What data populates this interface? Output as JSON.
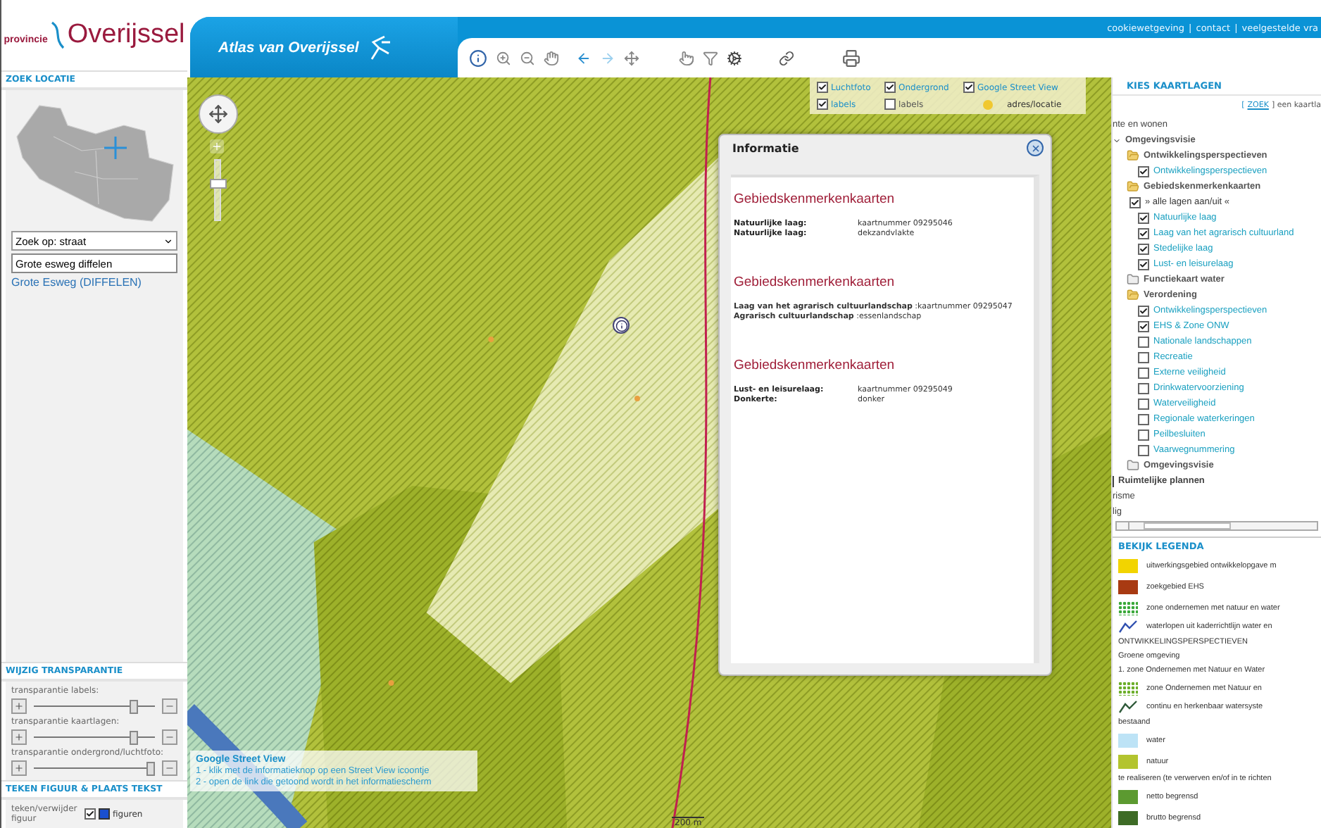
{
  "logo": {
    "prefix": "provincie",
    "name": "Overijssel"
  },
  "header": {
    "title": "Atlas van Overijssel",
    "separator": "|",
    "links": [
      {
        "label": "cookiewetgeving"
      },
      {
        "label": "contact"
      },
      {
        "label": "veelgestelde vra"
      }
    ]
  },
  "search_panel": {
    "title": "ZOEK LOCATIE",
    "select": {
      "value": "Zoek op: straat"
    },
    "input": {
      "value": "Grote esweg diffelen"
    },
    "results": [
      {
        "label": "Grote Esweg (DIFFELEN)"
      }
    ]
  },
  "transparency": {
    "title": "WIJZIG TRANSPARANTIE",
    "sliders": [
      {
        "label": "transparantie labels:",
        "level": 0.83
      },
      {
        "label": "transparantie kaartlagen:",
        "level": 0.83
      },
      {
        "label": "transparantie ondergrond/luchtfoto:",
        "level": 0.97
      }
    ]
  },
  "draw_panel": {
    "title": "TEKEN FIGUUR & PLAATS TEKST",
    "label": "teken/verwijder figuur",
    "checked": true,
    "option": "figuren"
  },
  "map": {
    "zoom": {
      "level": 0.62
    },
    "layers": [
      {
        "kind": "checkbox",
        "label": "Luchtfoto",
        "checked": true
      },
      {
        "kind": "checkbox",
        "label": "Ondergrond",
        "checked": true
      },
      {
        "kind": "checkbox",
        "label": "Google Street View",
        "checked": true
      },
      {
        "kind": "checkbox",
        "label": "labels",
        "checked": true
      },
      {
        "kind": "checkbox",
        "label": "labels",
        "checked": false
      },
      {
        "kind": "marker",
        "label": "adres/locatie"
      }
    ],
    "street_view": {
      "title": "Google Street View",
      "lines": [
        "1 - klik met de informatieknop op een Street View icoontje",
        "2 - open de link die getoond wordt in het informatiescherm"
      ]
    },
    "scale": "200 m"
  },
  "popup": {
    "title": "Informatie",
    "sections": [
      {
        "title": "Gebiedskenmerkenkaarten",
        "kind": "columns",
        "rows": [
          {
            "label": "Natuurlijke laag:",
            "value": "kaartnummer 09295046"
          },
          {
            "label": "Natuurlijke laag:",
            "value": "dekzandvlakte"
          }
        ]
      },
      {
        "title": "Gebiedskenmerkenkaarten",
        "kind": "inline",
        "rows": [
          {
            "text": "**Laag van het agrarisch cultuurlandschap** :kaartnummer 09295047"
          },
          {
            "text": "**Agrarisch cultuurlandschap** :essenlandschap"
          }
        ]
      },
      {
        "title": "Gebiedskenmerkenkaarten",
        "kind": "columns",
        "rows": [
          {
            "label": "Lust- en leisurelaag:",
            "value": "kaartnummer 09295049"
          },
          {
            "label": "Donkerte:",
            "value": "donker"
          }
        ]
      }
    ]
  },
  "layers_panel": {
    "title": "KIES KAARTLAGEN",
    "search_prefix": "[",
    "search_link": "ZOEK",
    "search_suffix": "] een kaartla",
    "tree": [
      {
        "kind": "text",
        "label": "nte en wonen"
      },
      {
        "kind": "group",
        "label": "Omgevingsvisie",
        "expanded": true,
        "children": [
          {
            "kind": "folder",
            "label": "Ontwikkelingsperspectieven",
            "expanded": true,
            "children": [
              {
                "kind": "layer",
                "label": "Ontwikkelingsperspectieven",
                "checked": true
              }
            ]
          },
          {
            "kind": "folder",
            "label": "Gebiedskenmerkenkaarten",
            "expanded": true,
            "children": [
              {
                "kind": "toggle",
                "label": "» alle lagen aan/uit «",
                "checked": true
              },
              {
                "kind": "layer",
                "label": "Natuurlijke laag",
                "checked": true
              },
              {
                "kind": "layer",
                "label": "Laag van het agrarisch cultuurland",
                "checked": true
              },
              {
                "kind": "layer",
                "label": "Stedelijke laag",
                "checked": true
              },
              {
                "kind": "layer",
                "label": "Lust- en leisurelaag",
                "checked": true
              }
            ]
          },
          {
            "kind": "folder",
            "label": "Functiekaart water",
            "expanded": false
          },
          {
            "kind": "folder",
            "label": "Verordening",
            "expanded": true,
            "children": [
              {
                "kind": "layer",
                "label": "Ontwikkelingsperspectieven",
                "checked": true
              },
              {
                "kind": "layer",
                "label": "EHS & Zone ONW",
                "checked": true
              },
              {
                "kind": "layer",
                "label": "Nationale landschappen",
                "checked": false
              },
              {
                "kind": "layer",
                "label": "Recreatie",
                "checked": false
              },
              {
                "kind": "layer",
                "label": "Externe veiligheid",
                "checked": false
              },
              {
                "kind": "layer",
                "label": "Drinkwatervoorziening",
                "checked": false
              },
              {
                "kind": "layer",
                "label": "Waterveiligheid",
                "checked": false
              },
              {
                "kind": "layer",
                "label": "Regionale waterkeringen",
                "checked": false
              },
              {
                "kind": "layer",
                "label": "Peilbesluiten",
                "checked": false
              },
              {
                "kind": "layer",
                "label": "Vaarwegnummering",
                "checked": false
              }
            ]
          },
          {
            "kind": "folder",
            "label": "Omgevingsvisie",
            "expanded": false
          }
        ]
      },
      {
        "kind": "section",
        "label": "Ruimtelijke plannen"
      },
      {
        "kind": "text",
        "label": "risme"
      },
      {
        "kind": "text",
        "label": "lig"
      }
    ]
  },
  "legend": {
    "title": "BEKIJK LEGENDA",
    "items": [
      {
        "kind": "swatch",
        "color": "#f2d400",
        "label": "uitwerkingsgebied ontwikkelopgave m"
      },
      {
        "kind": "swatch",
        "color": "#a83a12",
        "label": "zoekgebied EHS"
      },
      {
        "kind": "dots",
        "color": "#3aa83a",
        "label": "zone ondernemen met natuur en water"
      },
      {
        "kind": "line",
        "color": "#3050b0",
        "label": "waterlopen uit kaderrichtlijn water en"
      },
      {
        "kind": "heading",
        "label": "ONTWIKKELINGSPERSPECTIEVEN"
      },
      {
        "kind": "heading",
        "label": "Groene omgeving"
      },
      {
        "kind": "heading",
        "label": "1. zone Ondernemen met Natuur en Water"
      },
      {
        "kind": "dots",
        "color": "#6cae2a",
        "label": "zone Ondernemen met Natuur en"
      },
      {
        "kind": "line",
        "color": "#2f5a3a",
        "label": "continu en herkenbaar watersyste"
      },
      {
        "kind": "heading",
        "label": "bestaand"
      },
      {
        "kind": "swatch",
        "color": "#bde3f6",
        "label": "water"
      },
      {
        "kind": "swatch",
        "color": "#b3c42f",
        "label": "natuur"
      },
      {
        "kind": "heading",
        "label": "te realiseren (te verwerven en/of in te richten"
      },
      {
        "kind": "swatch",
        "color": "#5c9a30",
        "label": "netto begrensd"
      },
      {
        "kind": "swatch",
        "color": "#3e6b26",
        "label": "brutto begrensd"
      }
    ]
  }
}
